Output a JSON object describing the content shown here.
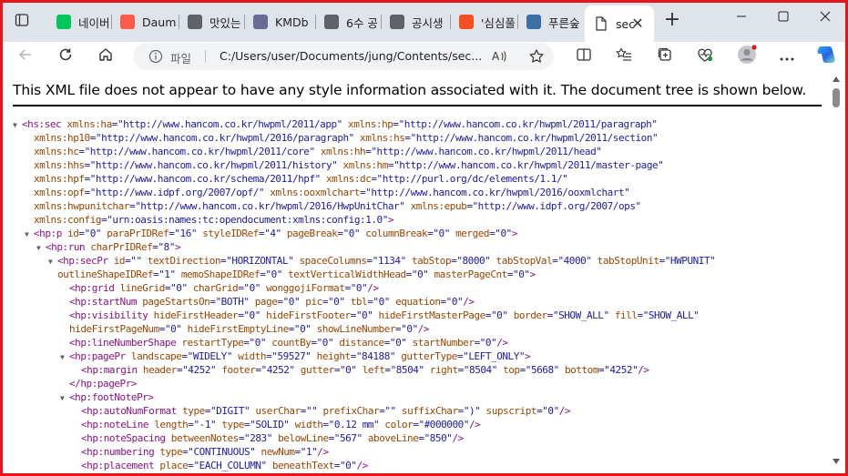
{
  "tabs": [
    {
      "title": "네이버",
      "icon": "naver-favicon",
      "color": "#03c75a"
    },
    {
      "title": "Daum",
      "icon": "daum-favicon",
      "color": "#ff5a4a"
    },
    {
      "title": "맛있는",
      "icon": "search-favicon",
      "color": "#5f6368"
    },
    {
      "title": "KMDb",
      "icon": "kmdb-favicon",
      "color": "#6b6b9a"
    },
    {
      "title": "6수 공",
      "icon": "search-favicon",
      "color": "#5f6368"
    },
    {
      "title": "공시생",
      "icon": "blocked-favicon",
      "color": "#5f6368"
    },
    {
      "title": "'심심풀",
      "icon": "windows-favicon",
      "color": "#f25022"
    },
    {
      "title": "푸른숲",
      "icon": "book-favicon",
      "color": "#3b6ea5"
    }
  ],
  "active_tab": {
    "title": "sec",
    "icon": "document-favicon"
  },
  "address": {
    "scheme_label": "파일",
    "url": "C:/Users/user/Documents/jung/Contents/sec..."
  },
  "notice": "This XML file does not appear to have any style information associated with it. The document tree is shown below.",
  "xml_lines": [
    {
      "indent": 0,
      "toggle": "▼",
      "segments": [
        {
          "t": "<hs:sec ",
          "c": "tag"
        },
        {
          "t": "xmlns:ha",
          "c": "an"
        },
        {
          "t": "=\"http://www.hancom.co.kr/hwpml/2011/app\" ",
          "c": "av"
        },
        {
          "t": "xmlns:hp",
          "c": "an"
        },
        {
          "t": "=\"http://www.hancom.co.kr/hwpml/2011/paragraph\"",
          "c": "av"
        }
      ]
    },
    {
      "indent": 1,
      "toggle": "",
      "segments": [
        {
          "t": "xmlns:hp10",
          "c": "an"
        },
        {
          "t": "=\"http://www.hancom.co.kr/hwpml/2016/paragraph\" ",
          "c": "av"
        },
        {
          "t": "xmlns:hs",
          "c": "an"
        },
        {
          "t": "=\"http://www.hancom.co.kr/hwpml/2011/section\"",
          "c": "av"
        }
      ]
    },
    {
      "indent": 1,
      "toggle": "",
      "segments": [
        {
          "t": "xmlns:hc",
          "c": "an"
        },
        {
          "t": "=\"http://www.hancom.co.kr/hwpml/2011/core\" ",
          "c": "av"
        },
        {
          "t": "xmlns:hh",
          "c": "an"
        },
        {
          "t": "=\"http://www.hancom.co.kr/hwpml/2011/head\"",
          "c": "av"
        }
      ]
    },
    {
      "indent": 1,
      "toggle": "",
      "segments": [
        {
          "t": "xmlns:hhs",
          "c": "an"
        },
        {
          "t": "=\"http://www.hancom.co.kr/hwpml/2011/history\" ",
          "c": "av"
        },
        {
          "t": "xmlns:hm",
          "c": "an"
        },
        {
          "t": "=\"http://www.hancom.co.kr/hwpml/2011/master-page\"",
          "c": "av"
        }
      ]
    },
    {
      "indent": 1,
      "toggle": "",
      "segments": [
        {
          "t": "xmlns:hpf",
          "c": "an"
        },
        {
          "t": "=\"http://www.hancom.co.kr/schema/2011/hpf\" ",
          "c": "av"
        },
        {
          "t": "xmlns:dc",
          "c": "an"
        },
        {
          "t": "=\"http://purl.org/dc/elements/1.1/\"",
          "c": "av"
        }
      ]
    },
    {
      "indent": 1,
      "toggle": "",
      "segments": [
        {
          "t": "xmlns:opf",
          "c": "an"
        },
        {
          "t": "=\"http://www.idpf.org/2007/opf/\" ",
          "c": "av"
        },
        {
          "t": "xmlns:ooxmlchart",
          "c": "an"
        },
        {
          "t": "=\"http://www.hancom.co.kr/hwpml/2016/ooxmlchart\"",
          "c": "av"
        }
      ]
    },
    {
      "indent": 1,
      "toggle": "",
      "segments": [
        {
          "t": "xmlns:hwpunitchar",
          "c": "an"
        },
        {
          "t": "=\"http://www.hancom.co.kr/hwpml/2016/HwpUnitChar\" ",
          "c": "av"
        },
        {
          "t": "xmlns:epub",
          "c": "an"
        },
        {
          "t": "=\"http://www.idpf.org/2007/ops\"",
          "c": "av"
        }
      ]
    },
    {
      "indent": 1,
      "toggle": "",
      "segments": [
        {
          "t": "xmlns:config",
          "c": "an"
        },
        {
          "t": "=\"urn:oasis:names:tc:opendocument:xmlns:config:1.0\"",
          "c": "av"
        },
        {
          "t": ">",
          "c": "tag"
        }
      ]
    },
    {
      "indent": 1,
      "toggle": "▼",
      "segments": [
        {
          "t": "<hp:p ",
          "c": "tag"
        },
        {
          "t": "id",
          "c": "an"
        },
        {
          "t": "=\"0\" ",
          "c": "av"
        },
        {
          "t": "paraPrIDRef",
          "c": "an"
        },
        {
          "t": "=\"16\" ",
          "c": "av"
        },
        {
          "t": "styleIDRef",
          "c": "an"
        },
        {
          "t": "=\"4\" ",
          "c": "av"
        },
        {
          "t": "pageBreak",
          "c": "an"
        },
        {
          "t": "=\"0\" ",
          "c": "av"
        },
        {
          "t": "columnBreak",
          "c": "an"
        },
        {
          "t": "=\"0\" ",
          "c": "av"
        },
        {
          "t": "merged",
          "c": "an"
        },
        {
          "t": "=\"0\"",
          "c": "av"
        },
        {
          "t": ">",
          "c": "tag"
        }
      ]
    },
    {
      "indent": 2,
      "toggle": "▼",
      "segments": [
        {
          "t": "<hp:run ",
          "c": "tag"
        },
        {
          "t": "charPrIDRef",
          "c": "an"
        },
        {
          "t": "=\"8\"",
          "c": "av"
        },
        {
          "t": ">",
          "c": "tag"
        }
      ]
    },
    {
      "indent": 3,
      "toggle": "▼",
      "segments": [
        {
          "t": "<hp:secPr ",
          "c": "tag"
        },
        {
          "t": "id",
          "c": "an"
        },
        {
          "t": "=\"\" ",
          "c": "av"
        },
        {
          "t": "textDirection",
          "c": "an"
        },
        {
          "t": "=\"HORIZONTAL\" ",
          "c": "av"
        },
        {
          "t": "spaceColumns",
          "c": "an"
        },
        {
          "t": "=\"1134\" ",
          "c": "av"
        },
        {
          "t": "tabStop",
          "c": "an"
        },
        {
          "t": "=\"8000\" ",
          "c": "av"
        },
        {
          "t": "tabStopVal",
          "c": "an"
        },
        {
          "t": "=\"4000\" ",
          "c": "av"
        },
        {
          "t": "tabStopUnit",
          "c": "an"
        },
        {
          "t": "=\"HWPUNIT\"",
          "c": "av"
        }
      ]
    },
    {
      "indent": 3,
      "toggle": "",
      "segments": [
        {
          "t": "outlineShapeIDRef",
          "c": "an"
        },
        {
          "t": "=\"1\" ",
          "c": "av"
        },
        {
          "t": "memoShapeIDRef",
          "c": "an"
        },
        {
          "t": "=\"0\" ",
          "c": "av"
        },
        {
          "t": "textVerticalWidthHead",
          "c": "an"
        },
        {
          "t": "=\"0\" ",
          "c": "av"
        },
        {
          "t": "masterPageCnt",
          "c": "an"
        },
        {
          "t": "=\"0\"",
          "c": "av"
        },
        {
          "t": ">",
          "c": "tag"
        }
      ]
    },
    {
      "indent": 4,
      "toggle": "",
      "segments": [
        {
          "t": "<hp:grid ",
          "c": "tag"
        },
        {
          "t": "lineGrid",
          "c": "an"
        },
        {
          "t": "=\"0\" ",
          "c": "av"
        },
        {
          "t": "charGrid",
          "c": "an"
        },
        {
          "t": "=\"0\" ",
          "c": "av"
        },
        {
          "t": "wonggojiFormat",
          "c": "an"
        },
        {
          "t": "=\"0\"",
          "c": "av"
        },
        {
          "t": "/>",
          "c": "tag"
        }
      ]
    },
    {
      "indent": 4,
      "toggle": "",
      "segments": [
        {
          "t": "<hp:startNum ",
          "c": "tag"
        },
        {
          "t": "pageStartsOn",
          "c": "an"
        },
        {
          "t": "=\"BOTH\" ",
          "c": "av"
        },
        {
          "t": "page",
          "c": "an"
        },
        {
          "t": "=\"0\" ",
          "c": "av"
        },
        {
          "t": "pic",
          "c": "an"
        },
        {
          "t": "=\"0\" ",
          "c": "av"
        },
        {
          "t": "tbl",
          "c": "an"
        },
        {
          "t": "=\"0\" ",
          "c": "av"
        },
        {
          "t": "equation",
          "c": "an"
        },
        {
          "t": "=\"0\"",
          "c": "av"
        },
        {
          "t": "/>",
          "c": "tag"
        }
      ]
    },
    {
      "indent": 4,
      "toggle": "",
      "segments": [
        {
          "t": "<hp:visibility ",
          "c": "tag"
        },
        {
          "t": "hideFirstHeader",
          "c": "an"
        },
        {
          "t": "=\"0\" ",
          "c": "av"
        },
        {
          "t": "hideFirstFooter",
          "c": "an"
        },
        {
          "t": "=\"0\" ",
          "c": "av"
        },
        {
          "t": "hideFirstMasterPage",
          "c": "an"
        },
        {
          "t": "=\"0\" ",
          "c": "av"
        },
        {
          "t": "border",
          "c": "an"
        },
        {
          "t": "=\"SHOW_ALL\" ",
          "c": "av"
        },
        {
          "t": "fill",
          "c": "an"
        },
        {
          "t": "=\"SHOW_ALL\"",
          "c": "av"
        }
      ]
    },
    {
      "indent": 4,
      "toggle": "",
      "back": true,
      "segments": [
        {
          "t": "hideFirstPageNum",
          "c": "an"
        },
        {
          "t": "=\"0\" ",
          "c": "av"
        },
        {
          "t": "hideFirstEmptyLine",
          "c": "an"
        },
        {
          "t": "=\"0\" ",
          "c": "av"
        },
        {
          "t": "showLineNumber",
          "c": "an"
        },
        {
          "t": "=\"0\"",
          "c": "av"
        },
        {
          "t": "/>",
          "c": "tag"
        }
      ]
    },
    {
      "indent": 4,
      "toggle": "",
      "segments": [
        {
          "t": "<hp:lineNumberShape ",
          "c": "tag"
        },
        {
          "t": "restartType",
          "c": "an"
        },
        {
          "t": "=\"0\" ",
          "c": "av"
        },
        {
          "t": "countBy",
          "c": "an"
        },
        {
          "t": "=\"0\" ",
          "c": "av"
        },
        {
          "t": "distance",
          "c": "an"
        },
        {
          "t": "=\"0\" ",
          "c": "av"
        },
        {
          "t": "startNumber",
          "c": "an"
        },
        {
          "t": "=\"0\"",
          "c": "av"
        },
        {
          "t": "/>",
          "c": "tag"
        }
      ]
    },
    {
      "indent": 4,
      "toggle": "▼",
      "segments": [
        {
          "t": "<hp:pagePr ",
          "c": "tag"
        },
        {
          "t": "landscape",
          "c": "an"
        },
        {
          "t": "=\"WIDELY\" ",
          "c": "av"
        },
        {
          "t": "width",
          "c": "an"
        },
        {
          "t": "=\"59527\" ",
          "c": "av"
        },
        {
          "t": "height",
          "c": "an"
        },
        {
          "t": "=\"84188\" ",
          "c": "av"
        },
        {
          "t": "gutterType",
          "c": "an"
        },
        {
          "t": "=\"LEFT_ONLY\"",
          "c": "av"
        },
        {
          "t": ">",
          "c": "tag"
        }
      ]
    },
    {
      "indent": 5,
      "toggle": "",
      "segments": [
        {
          "t": "<hp:margin ",
          "c": "tag"
        },
        {
          "t": "header",
          "c": "an"
        },
        {
          "t": "=\"4252\" ",
          "c": "av"
        },
        {
          "t": "footer",
          "c": "an"
        },
        {
          "t": "=\"4252\" ",
          "c": "av"
        },
        {
          "t": "gutter",
          "c": "an"
        },
        {
          "t": "=\"0\" ",
          "c": "av"
        },
        {
          "t": "left",
          "c": "an"
        },
        {
          "t": "=\"8504\" ",
          "c": "av"
        },
        {
          "t": "right",
          "c": "an"
        },
        {
          "t": "=\"8504\" ",
          "c": "av"
        },
        {
          "t": "top",
          "c": "an"
        },
        {
          "t": "=\"5668\" ",
          "c": "av"
        },
        {
          "t": "bottom",
          "c": "an"
        },
        {
          "t": "=\"4252\"",
          "c": "av"
        },
        {
          "t": "/>",
          "c": "tag"
        }
      ]
    },
    {
      "indent": 4,
      "toggle": "",
      "segments": [
        {
          "t": "</hp:pagePr>",
          "c": "tag"
        }
      ]
    },
    {
      "indent": 4,
      "toggle": "▼",
      "segments": [
        {
          "t": "<hp:footNotePr>",
          "c": "tag"
        }
      ]
    },
    {
      "indent": 5,
      "toggle": "",
      "segments": [
        {
          "t": "<hp:autoNumFormat ",
          "c": "tag"
        },
        {
          "t": "type",
          "c": "an"
        },
        {
          "t": "=\"DIGIT\" ",
          "c": "av"
        },
        {
          "t": "userChar",
          "c": "an"
        },
        {
          "t": "=\"\" ",
          "c": "av"
        },
        {
          "t": "prefixChar",
          "c": "an"
        },
        {
          "t": "=\"\" ",
          "c": "av"
        },
        {
          "t": "suffixChar",
          "c": "an"
        },
        {
          "t": "=\")\" ",
          "c": "av"
        },
        {
          "t": "supscript",
          "c": "an"
        },
        {
          "t": "=\"0\"",
          "c": "av"
        },
        {
          "t": "/>",
          "c": "tag"
        }
      ]
    },
    {
      "indent": 5,
      "toggle": "",
      "segments": [
        {
          "t": "<hp:noteLine ",
          "c": "tag"
        },
        {
          "t": "length",
          "c": "an"
        },
        {
          "t": "=\"-1\" ",
          "c": "av"
        },
        {
          "t": "type",
          "c": "an"
        },
        {
          "t": "=\"SOLID\" ",
          "c": "av"
        },
        {
          "t": "width",
          "c": "an"
        },
        {
          "t": "=\"0.12 mm\" ",
          "c": "av"
        },
        {
          "t": "color",
          "c": "an"
        },
        {
          "t": "=\"#000000\"",
          "c": "av"
        },
        {
          "t": "/>",
          "c": "tag"
        }
      ]
    },
    {
      "indent": 5,
      "toggle": "",
      "segments": [
        {
          "t": "<hp:noteSpacing ",
          "c": "tag"
        },
        {
          "t": "betweenNotes",
          "c": "an"
        },
        {
          "t": "=\"283\" ",
          "c": "av"
        },
        {
          "t": "belowLine",
          "c": "an"
        },
        {
          "t": "=\"567\" ",
          "c": "av"
        },
        {
          "t": "aboveLine",
          "c": "an"
        },
        {
          "t": "=\"850\"",
          "c": "av"
        },
        {
          "t": "/>",
          "c": "tag"
        }
      ]
    },
    {
      "indent": 5,
      "toggle": "",
      "segments": [
        {
          "t": "<hp:numbering ",
          "c": "tag"
        },
        {
          "t": "type",
          "c": "an"
        },
        {
          "t": "=\"CONTINUOUS\" ",
          "c": "av"
        },
        {
          "t": "newNum",
          "c": "an"
        },
        {
          "t": "=\"1\"",
          "c": "av"
        },
        {
          "t": "/>",
          "c": "tag"
        }
      ]
    },
    {
      "indent": 5,
      "toggle": "",
      "segments": [
        {
          "t": "<hp:placement ",
          "c": "tag"
        },
        {
          "t": "place",
          "c": "an"
        },
        {
          "t": "=\"EACH_COLUMN\" ",
          "c": "av"
        },
        {
          "t": "beneathText",
          "c": "an"
        },
        {
          "t": "=\"0\"",
          "c": "av"
        },
        {
          "t": "/>",
          "c": "tag"
        }
      ]
    }
  ]
}
